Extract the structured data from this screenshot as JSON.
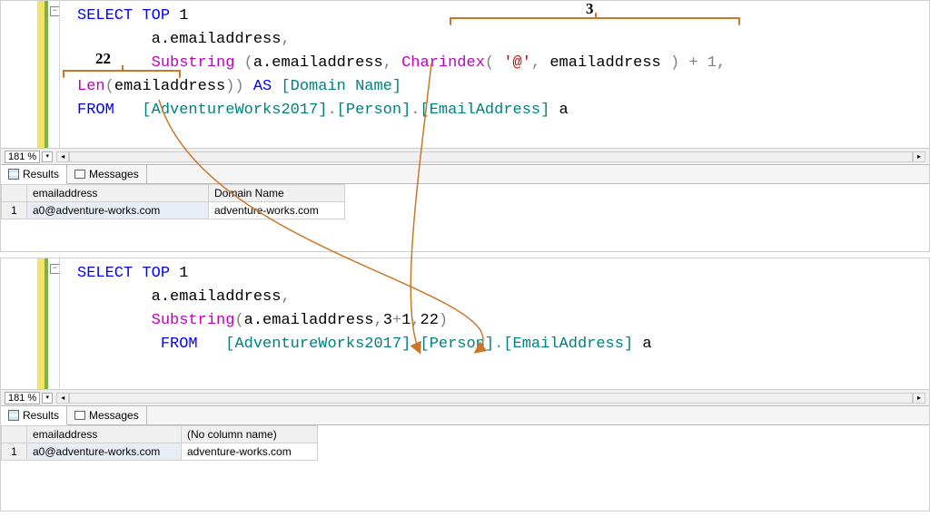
{
  "top": {
    "zoom": "181 %",
    "collapse_glyph": "−",
    "annotations": {
      "n3": "3",
      "n22": "22"
    },
    "code": {
      "select": "SELECT",
      "top": "TOP",
      "one": "1",
      "alias_email": "a.emailaddress",
      "comma": ",",
      "substring": "Substring",
      "open_sp": " (",
      "open": "(",
      "close": ")",
      "charindex": "Charindex",
      "at_literal": "'@'",
      "emailaddress": "emailaddress",
      "plus_one": " + 1",
      "len": "Len",
      "close_close": "))",
      "as": "AS",
      "domain_name": "[Domain Name]",
      "from": "FROM",
      "db": "[AdventureWorks2017]",
      "dot": ".",
      "person": "[Person]",
      "email_tbl": "[EmailAddress]",
      "a": "a"
    },
    "tabs": {
      "results": "Results",
      "messages": "Messages"
    },
    "grid": {
      "headers": [
        "",
        "emailaddress",
        "Domain Name"
      ],
      "rows": [
        [
          "1",
          "a0@adventure-works.com",
          "adventure-works.com"
        ]
      ]
    }
  },
  "bottom": {
    "zoom": "181 %",
    "collapse_glyph": "−",
    "code": {
      "select": "SELECT",
      "top": "TOP",
      "one": "1",
      "alias_email": "a.emailaddress",
      "comma": ",",
      "substring": "Substring",
      "open": "(",
      "close": ")",
      "three": "3",
      "plus": "+",
      "one2": "1",
      "twtwo": "22",
      "from": "FROM",
      "db": "[AdventureWorks2017]",
      "dot": ".",
      "person": "[Person]",
      "email_tbl": "[EmailAddress]",
      "a": "a"
    },
    "tabs": {
      "results": "Results",
      "messages": "Messages"
    },
    "grid": {
      "headers": [
        "",
        "emailaddress",
        "(No column name)"
      ],
      "rows": [
        [
          "1",
          "a0@adventure-works.com",
          "adventure-works.com"
        ]
      ]
    }
  }
}
